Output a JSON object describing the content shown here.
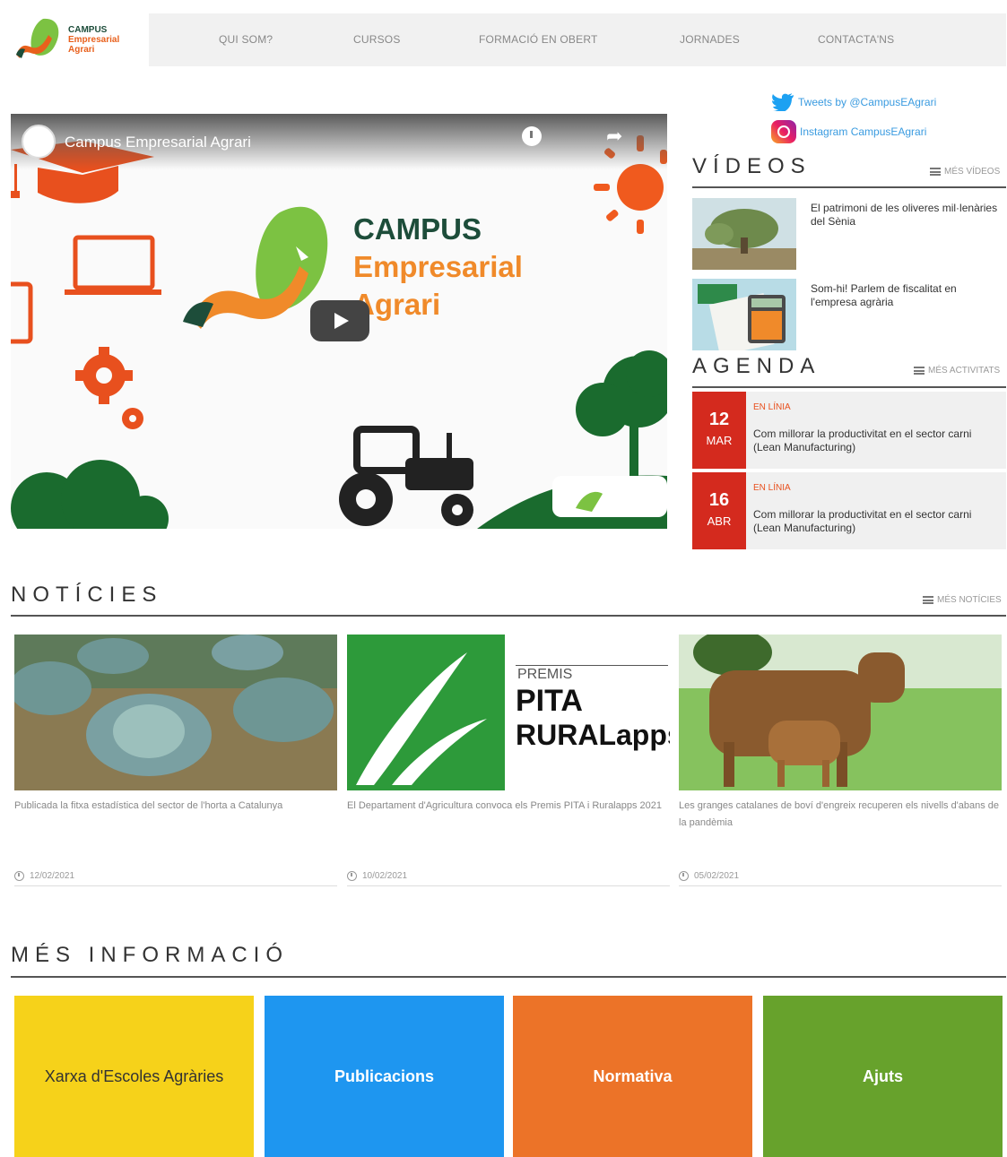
{
  "logo": {
    "line1": "CAMPUS",
    "line2": "Empresarial",
    "line3": "Agrari"
  },
  "nav": {
    "items": [
      "QUI SOM?",
      "CURSOS",
      "FORMACIÓ EN OBERT",
      "JORNADES",
      "CONTACTA'NS"
    ]
  },
  "social": {
    "twitter": "Tweets by @CampusEAgrari",
    "instagram": "Instagram CampusEAgrari"
  },
  "video_player": {
    "title": "Campus Empresarial Agrari",
    "thumbnail_title": [
      "CAMPUS",
      "Empresarial",
      "Agrari"
    ]
  },
  "videos": {
    "heading": "VÍDEOS",
    "more": "MÉS VÍDEOS",
    "items": [
      {
        "title": "El patrimoni de les oliveres mil·lenàries del Sènia"
      },
      {
        "title": "Som-hi! Parlem de fiscalitat en l'empresa agrària"
      }
    ]
  },
  "agenda": {
    "heading": "AGENDA",
    "more": "MÉS ACTIVITATS",
    "items": [
      {
        "day": "12",
        "month": "MAR",
        "tag": "EN LÍNIA",
        "title": "Com millorar la productivitat en el sector carni (Lean Manufacturing)"
      },
      {
        "day": "16",
        "month": "ABR",
        "tag": "EN LÍNIA",
        "title": "Com millorar la productivitat en el sector carni (Lean Manufacturing)"
      }
    ]
  },
  "news": {
    "heading": "NOTÍCIES",
    "more": "MÉS NOTÍCIES",
    "items": [
      {
        "title": "Publicada la fitxa estadística del sector de l'horta a Catalunya",
        "date": "12/02/2021"
      },
      {
        "title": "El Departament d'Agricultura convoca els Premis PITA i Ruralapps 2021",
        "date": "10/02/2021",
        "image_text": {
          "premis": "PREMIS",
          "pita": "PITA",
          "ruralapps": "RURALapps"
        }
      },
      {
        "title": "Les granges catalanes de boví d'engreix recuperen els nivells d'abans de la pandèmia",
        "date": "05/02/2021"
      }
    ]
  },
  "more_info": {
    "heading": "MÉS INFORMACIÓ",
    "tiles": [
      {
        "label": "Xarxa d'Escoles Agràries",
        "color": "#f6d21a",
        "text_color": "#333333"
      },
      {
        "label": "Publicacions",
        "color": "#1e96f0",
        "text_color": "#ffffff"
      },
      {
        "label": "Normativa",
        "color": "#ec7328",
        "text_color": "#ffffff"
      },
      {
        "label": "Ajuts",
        "color": "#67a22c",
        "text_color": "#ffffff"
      }
    ]
  },
  "colors": {
    "agenda_red": "#d42a1e",
    "brand_green": "#1d4d3a",
    "brand_orange": "#f08a2a"
  }
}
